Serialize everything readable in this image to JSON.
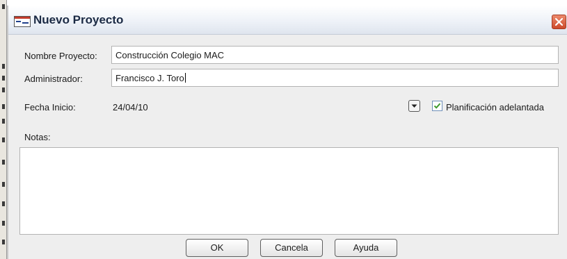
{
  "window": {
    "title": "Nuevo Proyecto"
  },
  "form": {
    "project_name": {
      "label": "Nombre Proyecto:",
      "value": "Construcción Colegio MAC"
    },
    "administrator": {
      "label": "Administrador:",
      "value": "Francisco J. Toro"
    },
    "start_date": {
      "label": "Fecha Inicio:",
      "value": "24/04/10"
    },
    "advanced_planning": {
      "label": "Planificación adelantada",
      "checked": true
    },
    "notes": {
      "label": "Notas:",
      "value": ""
    }
  },
  "buttons": {
    "ok": "OK",
    "cancel": "Cancela",
    "help": "Ayuda"
  },
  "colors": {
    "close": "#cd4a2b",
    "title_text": "#1b2a44",
    "check": "#3f9a2e"
  }
}
